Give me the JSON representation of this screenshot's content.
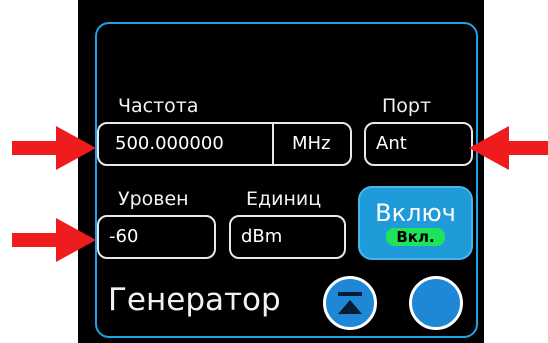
{
  "colors": {
    "accent": "#1fa3e6",
    "button": "#1e88d6",
    "on_indicator": "#1fe35a",
    "annotation_arrow": "#ee1c1c"
  },
  "frequency": {
    "label": "Частота",
    "value": "500.000000",
    "unit": "MHz"
  },
  "port": {
    "label": "Порт",
    "value": "Ant"
  },
  "level": {
    "label": "Уровен",
    "value": "-60"
  },
  "units": {
    "label": "Единиц",
    "value": "dBm"
  },
  "output_toggle": {
    "label": "Включ",
    "state": "Вкл."
  },
  "page_title": "Генератор",
  "icons": {
    "collapse": "collapse-icon",
    "circle": "circle-button-icon",
    "arrows": "red-arrow-icon"
  }
}
